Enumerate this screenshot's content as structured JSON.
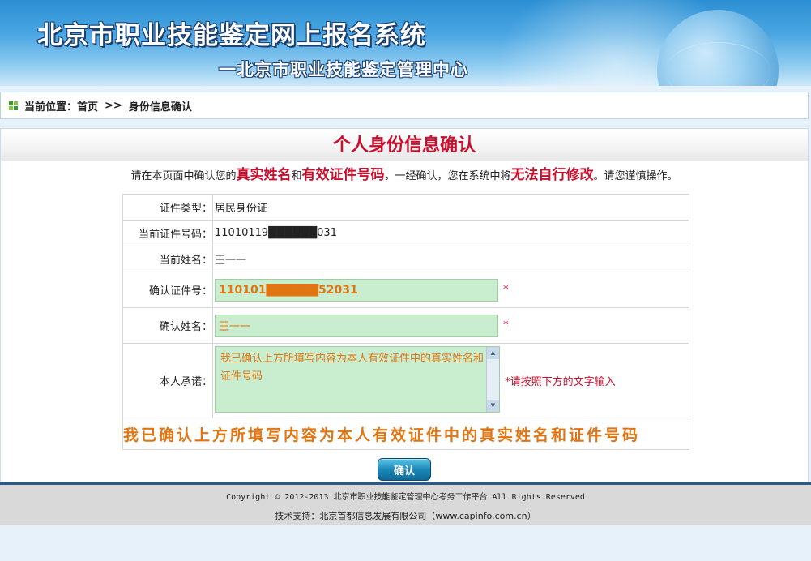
{
  "header": {
    "title": "北京市职业技能鉴定网上报名系统",
    "subtitle": "一北京市职业技能鉴定管理中心"
  },
  "breadcrumb": {
    "label": "当前位置：",
    "home": "首页",
    "separator": ">>",
    "current": "身份信息确认"
  },
  "panel": {
    "title": "个人身份信息确认",
    "notice": {
      "part1": "请在本页面中确认您的",
      "hl1": "真实姓名",
      "part2": "和",
      "hl2": "有效证件号码",
      "part3": "，一经确认，您在系统中将",
      "hl3": "无法自行修改",
      "part4": "。请您谨慎操作。"
    }
  },
  "form": {
    "id_type_label": "证件类型：",
    "id_type_value": "居民身份证",
    "current_id_label": "当前证件号码：",
    "current_id_value": "11010119██████031",
    "current_name_label": "当前姓名：",
    "current_name_value": "王一一",
    "confirm_id_label": "确认证件号：",
    "confirm_id_value": "110101██████52031",
    "confirm_name_label": "确认姓名：",
    "confirm_name_value": "王一一",
    "pledge_label": "本人承诺：",
    "pledge_value": "我已确认上方所填写内容为本人有效证件中的真实姓名和证件号码",
    "required_mark": "*",
    "pledge_hint": "*请按照下方的文字输入",
    "slogan": "我已确认上方所填写内容为本人有效证件中的真实姓名和证件号码"
  },
  "actions": {
    "confirm_label": "确认"
  },
  "footer": {
    "copyright": "Copyright © 2012-2013 北京市职业技能鉴定管理中心考务工作平台 All Rights Reserved",
    "support": "技术支持：北京首都信息发展有限公司（www.capinfo.com.cn）"
  },
  "colors": {
    "accent_red": "#c8102e",
    "input_bg": "#c9edcf",
    "input_text": "#e07512",
    "button_blue": "#1b88b8"
  }
}
